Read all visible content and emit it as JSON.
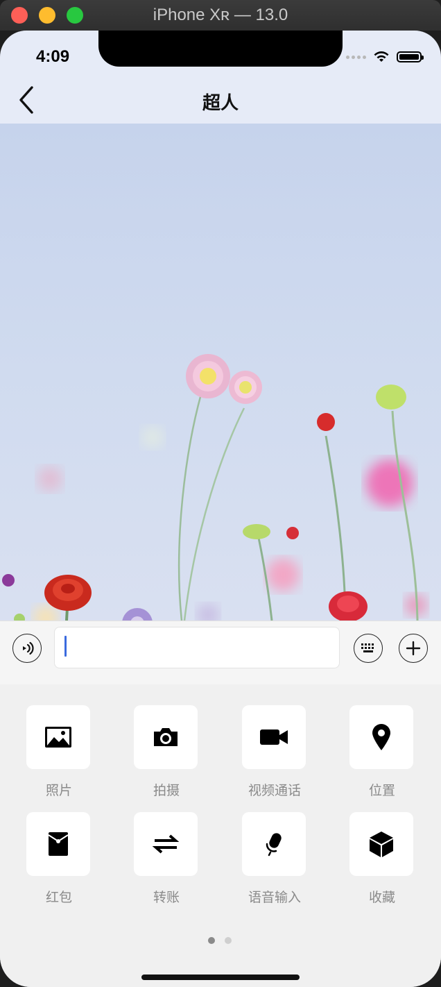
{
  "window": {
    "title": "iPhone Xʀ — 13.0"
  },
  "status_bar": {
    "time": "4:09"
  },
  "nav": {
    "title": "超人"
  },
  "input": {
    "value": ""
  },
  "panel": {
    "items": [
      {
        "label": "照片",
        "icon": "photo-icon"
      },
      {
        "label": "拍摄",
        "icon": "camera-icon"
      },
      {
        "label": "视频通话",
        "icon": "video-call-icon"
      },
      {
        "label": "位置",
        "icon": "location-icon"
      },
      {
        "label": "红包",
        "icon": "red-envelope-icon"
      },
      {
        "label": "转账",
        "icon": "transfer-icon"
      },
      {
        "label": "语音输入",
        "icon": "microphone-icon"
      },
      {
        "label": "收藏",
        "icon": "favorites-box-icon"
      }
    ],
    "page_count": 2,
    "active_page": 1
  }
}
